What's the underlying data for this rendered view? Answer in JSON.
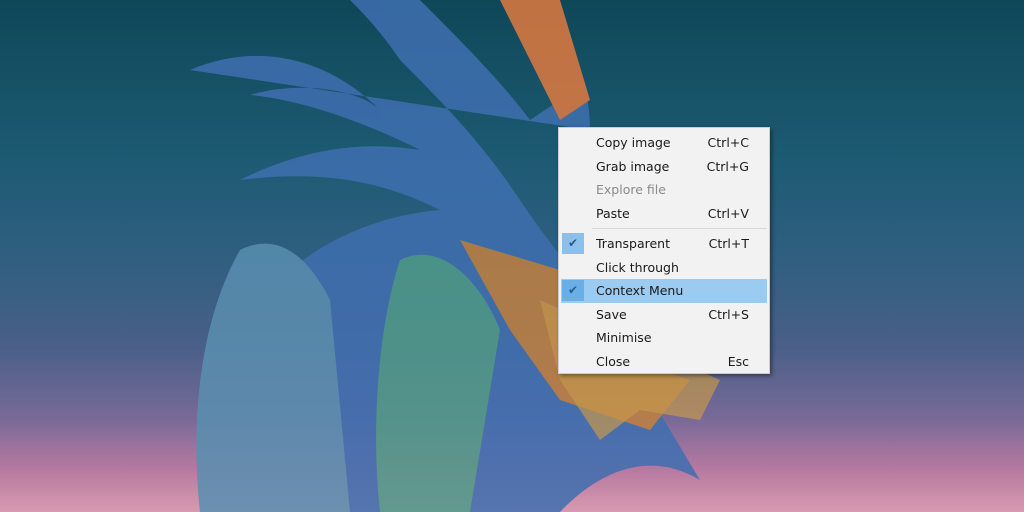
{
  "context_menu": {
    "items": [
      {
        "label": "Copy image",
        "shortcut": "Ctrl+C"
      },
      {
        "label": "Grab image",
        "shortcut": "Ctrl+G"
      },
      {
        "label": "Explore file",
        "shortcut": ""
      },
      {
        "label": "Paste",
        "shortcut": "Ctrl+V"
      },
      {
        "label": "Transparent",
        "shortcut": "Ctrl+T"
      },
      {
        "label": "Click through",
        "shortcut": ""
      },
      {
        "label": "Context Menu",
        "shortcut": ""
      },
      {
        "label": "Save",
        "shortcut": "Ctrl+S"
      },
      {
        "label": "Minimise",
        "shortcut": ""
      },
      {
        "label": "Close",
        "shortcut": "Esc"
      }
    ],
    "check_glyph": "✔"
  }
}
